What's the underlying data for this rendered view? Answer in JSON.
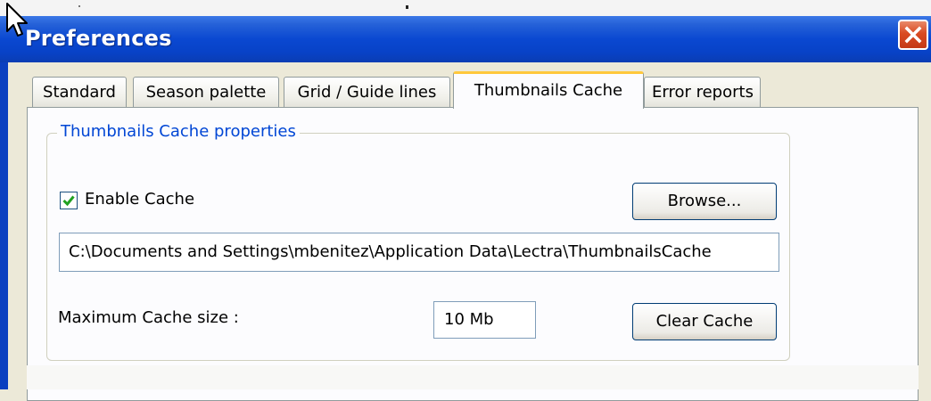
{
  "window": {
    "title": "Preferences"
  },
  "tabs": [
    {
      "label": "Standard"
    },
    {
      "label": "Season palette"
    },
    {
      "label": "Grid / Guide lines"
    },
    {
      "label": "Thumbnails Cache"
    },
    {
      "label": "Error reports"
    }
  ],
  "active_tab": "Thumbnails Cache",
  "cache": {
    "group_label": "Thumbnails Cache properties",
    "enable_label": "Enable Cache",
    "enabled": true,
    "browse_label": "Browse...",
    "path_value": "C:\\Documents and Settings\\mbenitez\\Application Data\\Lectra\\ThumbnailsCache",
    "max_size_label": "Maximum Cache size :",
    "max_size_value": "10 Mb",
    "clear_label": "Clear Cache"
  },
  "icons": {
    "close": "close-icon",
    "check": "check-icon",
    "cursor": "mouse-cursor-icon"
  },
  "colors": {
    "titlebar": "#0a48d1",
    "close_button": "#d94a22",
    "group_label": "#0046d5",
    "active_tab_highlight": "#ffc83c",
    "check": "#21a121"
  }
}
